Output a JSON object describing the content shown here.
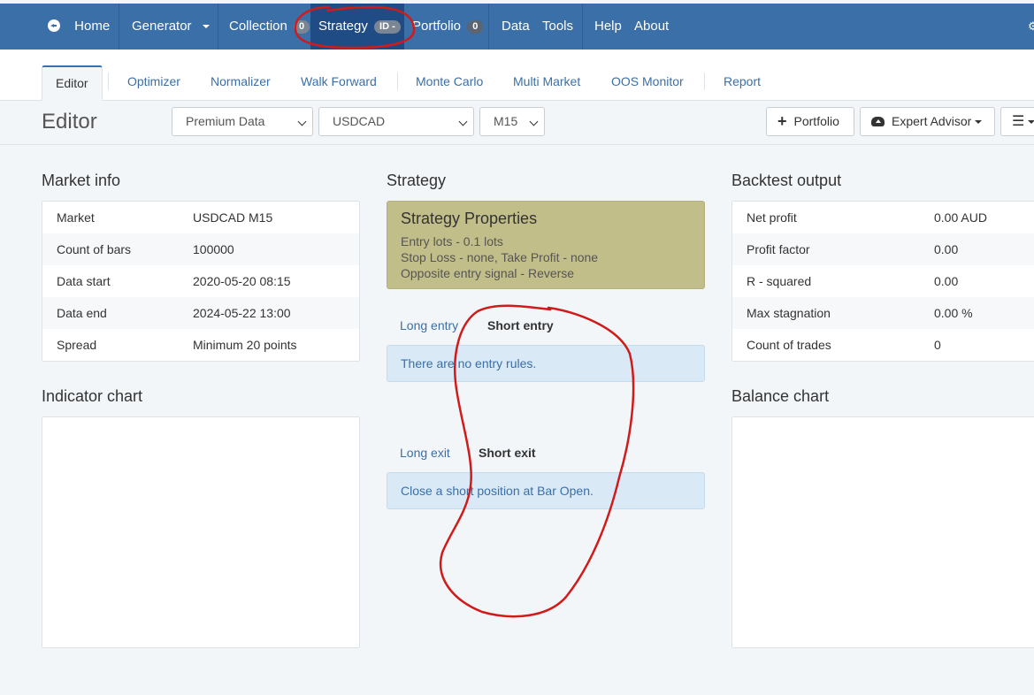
{
  "nav": {
    "home": "Home",
    "generator": "Generator",
    "collection": "Collection",
    "collection_count": "0",
    "strategy": "Strategy",
    "strategy_badge": "ID -",
    "portfolio": "Portfolio",
    "portfolio_count": "0",
    "data": "Data",
    "tools": "Tools",
    "help": "Help",
    "about": "About"
  },
  "tabs": [
    "Editor",
    "Optimizer",
    "Normalizer",
    "Walk Forward",
    "Monte Carlo",
    "Multi Market",
    "OOS Monitor",
    "Report"
  ],
  "toolbar": {
    "title": "Editor",
    "data_source": "Premium Data",
    "symbol": "USDCAD",
    "period": "M15",
    "portfolio_button": "Portfolio",
    "expert_advisor_button": "Expert Advisor"
  },
  "market_info": {
    "title": "Market info",
    "rows": [
      {
        "key": "Market",
        "value": "USDCAD M15"
      },
      {
        "key": "Count of bars",
        "value": "100000"
      },
      {
        "key": "Data start",
        "value": "2020-05-20 08:15"
      },
      {
        "key": "Data end",
        "value": "2024-05-22 13:00"
      },
      {
        "key": "Spread",
        "value": "Minimum 20 points"
      }
    ]
  },
  "strategy": {
    "title": "Strategy",
    "properties_title": "Strategy Properties",
    "properties_lines": [
      "Entry lots - 0.1 lots",
      "Stop Loss - none, Take Profit - none",
      "Opposite entry signal - Reverse"
    ],
    "long_entry": "Long entry",
    "short_entry": "Short entry",
    "entry_message": "There are no entry rules.",
    "long_exit": "Long exit",
    "short_exit": "Short exit",
    "exit_message": "Close a short position at Bar Open."
  },
  "backtest": {
    "title": "Backtest output",
    "rows": [
      {
        "key": "Net profit",
        "value": "0.00 AUD"
      },
      {
        "key": "Profit factor",
        "value": "0.00"
      },
      {
        "key": "R - squared",
        "value": "0.00"
      },
      {
        "key": "Max stagnation",
        "value": "0.00 %"
      },
      {
        "key": "Count of trades",
        "value": "0"
      }
    ]
  },
  "indicator_chart": {
    "title": "Indicator chart"
  },
  "balance_chart": {
    "title": "Balance chart"
  },
  "colors": {
    "navbar": "#3a6fa8",
    "navbar_active": "#1f4c84",
    "properties_bg": "#c2be8a",
    "annotation": "#d11a1a"
  }
}
